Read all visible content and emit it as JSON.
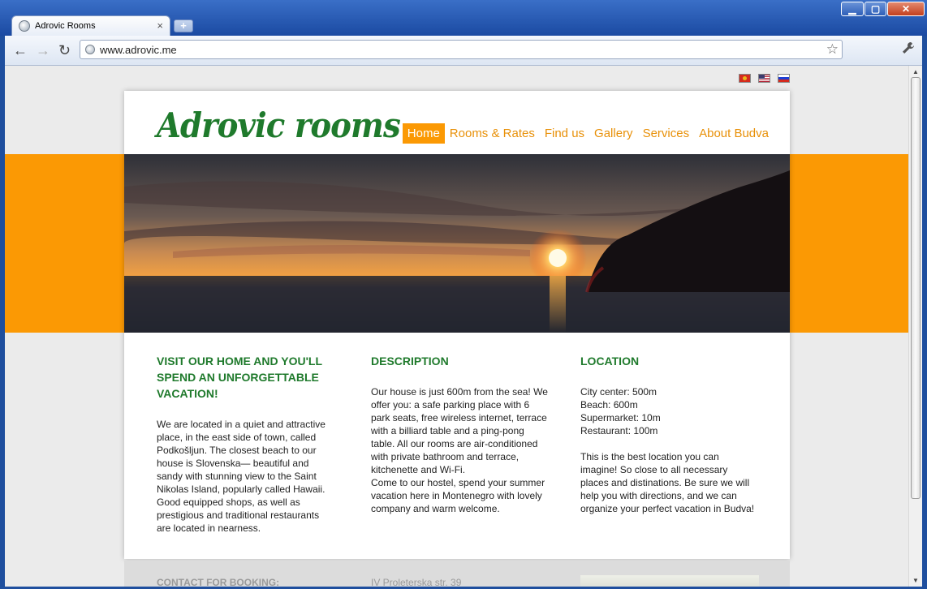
{
  "browser": {
    "tab_title": "Adrovic Rooms",
    "tab_close": "×",
    "new_tab": "+",
    "url": "www.adrovic.me",
    "window_controls": {
      "minimize": "▁",
      "maximize": "▢",
      "close": "✕"
    },
    "back_label": "←",
    "forward_label": "→",
    "reload_label": "↻",
    "star_icon": "☆",
    "wrench_icon": "🔧"
  },
  "page": {
    "logo": "Adrovic rooms",
    "languages": [
      "Montenegrin flag",
      "English flag",
      "Russian flag"
    ],
    "nav": [
      {
        "label": "Home",
        "active": true
      },
      {
        "label": "Rooms & Rates",
        "active": false
      },
      {
        "label": "Find us",
        "active": false
      },
      {
        "label": "Gallery",
        "active": false
      },
      {
        "label": "Services",
        "active": false
      },
      {
        "label": "About Budva",
        "active": false
      }
    ],
    "accent_color": "#fb9904",
    "heading_color": "#1f7a2c",
    "columns": [
      {
        "heading": "VISIT OUR HOME AND YOU'LL SPEND AN UNFORGETTABLE VACATION!",
        "body": "We are located in a quiet and attractive place, in the east side of town, called Podkošljun. The closest beach to our house is Slovenska— beautiful and sandy with stunning view to the Saint Nikolas Island, popularly called Hawaii. Good equipped shops, as well as prestigious and traditional restaurants are located in nearness."
      },
      {
        "heading": "DESCRIPTION",
        "body": "Our house is just 600m from the sea! We offer you: a safe parking place with 6 park seats, free wireless internet, terrace with a billiard table and a ping-pong table. All our rooms are air-conditioned with private bathroom and terrace, kitchenette and Wi-Fi.\nCome to our hostel, spend your summer vacation here in Montenegro with lovely company and warm welcome."
      },
      {
        "heading": "LOCATION",
        "body": "City center: 500m\nBeach: 600m\nSupermarket: 10m\nRestaurant: 100m\n\nThis is the best location you can imagine! So close to all necessary places and distinations. Be sure we will help you with directions, and we can organize your perfect vacation in Budva!"
      }
    ],
    "footer": {
      "contact_heading": "CONTACT FOR BOOKING:",
      "address": "IV Proleterska str. 39"
    }
  }
}
